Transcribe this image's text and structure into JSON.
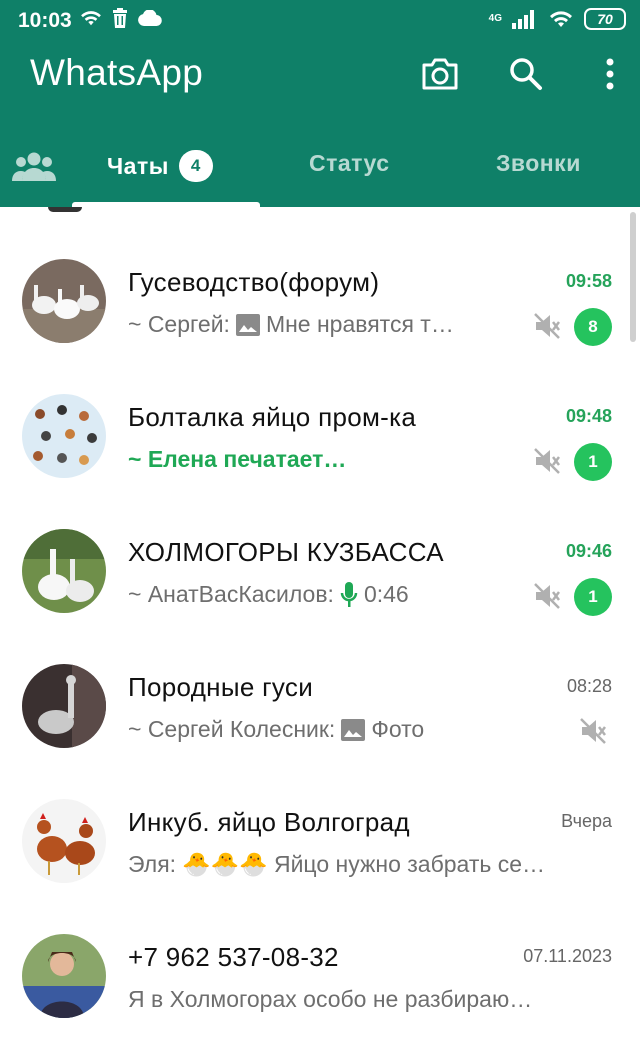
{
  "statusbar": {
    "time": "10:03",
    "network": "4G",
    "battery": "70"
  },
  "header": {
    "title": "WhatsApp",
    "icons": [
      "camera-icon",
      "search-icon",
      "menu-icon"
    ]
  },
  "tabs": {
    "community_icon": "community-icon",
    "chats_label": "Чаты",
    "chats_badge": "4",
    "status_label": "Статус",
    "calls_label": "Звонки"
  },
  "colors": {
    "header": "#0f8068",
    "unread_badge": "#25c35e",
    "time_active": "#25a35a",
    "typing": "#1fa855"
  },
  "chats": [
    {
      "name": "Гусеводство(форум)",
      "time": "09:58",
      "time_active": true,
      "sender": "~ Сергей:",
      "media_icon": "image-icon",
      "text": "Мне нравятся т…",
      "muted": true,
      "unread": "8"
    },
    {
      "name": "Болталка яйцо пром-ка",
      "time": "09:48",
      "time_active": true,
      "typing_text": "~ Елена печатает…",
      "muted": true,
      "unread": "1"
    },
    {
      "name": "ХОЛМОГОРЫ КУЗБАССА",
      "time": "09:46",
      "time_active": true,
      "sender": "~ АнатВасКасилов:",
      "media_icon": "mic-icon",
      "text": "0:46",
      "muted": true,
      "unread": "1"
    },
    {
      "name": "Породные гуси",
      "time": "08:28",
      "time_active": false,
      "sender": "~ Сергей Колесник:",
      "media_icon": "image-icon",
      "text": "Фото",
      "muted": true
    },
    {
      "name": "Инкуб. яйцо Волгоград",
      "time": "Вчера",
      "time_active": false,
      "sender": "Эля:",
      "emoji": "🐣🐣🐣",
      "text": "Яйцо нужно забрать се…",
      "muted": false
    },
    {
      "name": "+7 962 537-08-32",
      "time": "07.11.2023",
      "time_active": false,
      "text": "Я в Холмогорах особо не разбираю…",
      "muted": false
    }
  ]
}
